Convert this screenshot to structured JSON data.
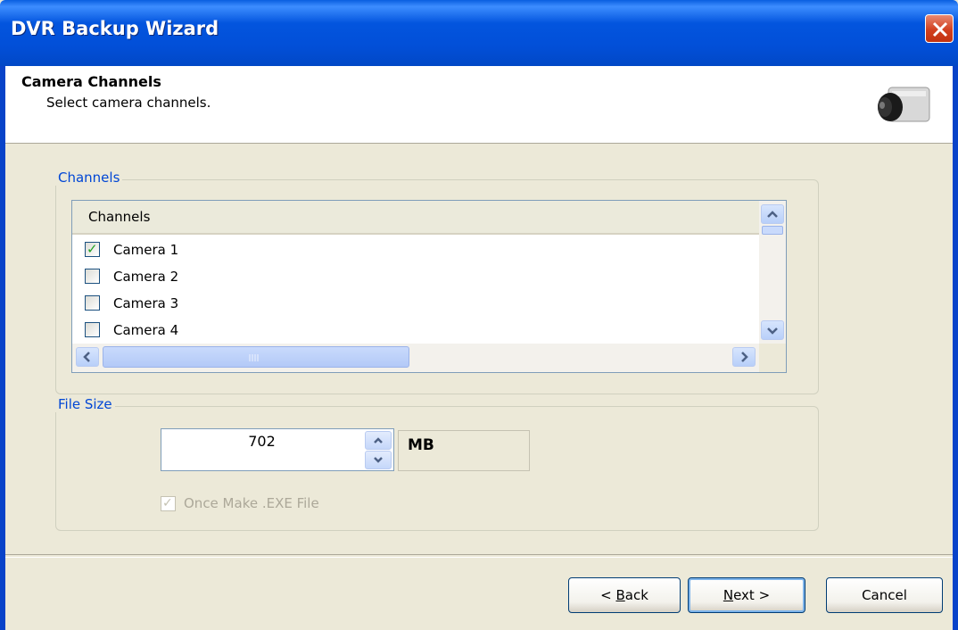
{
  "window": {
    "title": "DVR Backup Wizard"
  },
  "header": {
    "title": "Camera Channels",
    "subtitle": "Select camera channels."
  },
  "channels_group": {
    "label": "Channels",
    "column_header": "Channels",
    "items": [
      {
        "label": "Camera 1",
        "checked": true
      },
      {
        "label": "Camera 2",
        "checked": false
      },
      {
        "label": "Camera 3",
        "checked": false
      },
      {
        "label": "Camera 4",
        "checked": false
      }
    ]
  },
  "file_size_group": {
    "label": "File Size",
    "value": "702",
    "unit": "MB",
    "exe_checkbox": {
      "label": "Once Make .EXE File",
      "checked": true,
      "enabled": false
    }
  },
  "buttons": {
    "back": {
      "prefix": "< ",
      "accel": "B",
      "rest": "ack"
    },
    "next": {
      "accel": "N",
      "rest": "ext >"
    },
    "cancel": "Cancel"
  },
  "colors": {
    "titlebar": "#0355de",
    "group_label": "#0046d5",
    "close": "#d2401f",
    "checkmark": "#21a121"
  }
}
